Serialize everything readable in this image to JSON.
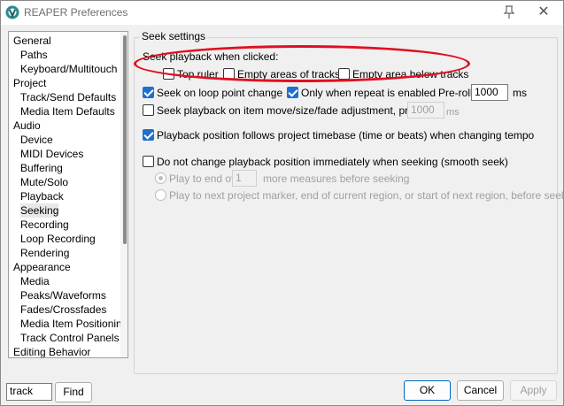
{
  "window": {
    "title": "REAPER Preferences"
  },
  "nav": {
    "items": [
      {
        "label": "General",
        "level": "cat"
      },
      {
        "label": "Paths",
        "level": "sub"
      },
      {
        "label": "Keyboard/Multitouch",
        "level": "sub"
      },
      {
        "label": "Project",
        "level": "cat"
      },
      {
        "label": "Track/Send Defaults",
        "level": "sub"
      },
      {
        "label": "Media Item Defaults",
        "level": "sub"
      },
      {
        "label": "Audio",
        "level": "cat"
      },
      {
        "label": "Device",
        "level": "sub"
      },
      {
        "label": "MIDI Devices",
        "level": "sub"
      },
      {
        "label": "Buffering",
        "level": "sub"
      },
      {
        "label": "Mute/Solo",
        "level": "sub"
      },
      {
        "label": "Playback",
        "level": "sub"
      },
      {
        "label": "Seeking",
        "level": "sub",
        "selected": true
      },
      {
        "label": "Recording",
        "level": "sub"
      },
      {
        "label": "Loop Recording",
        "level": "sub"
      },
      {
        "label": "Rendering",
        "level": "sub"
      },
      {
        "label": "Appearance",
        "level": "cat"
      },
      {
        "label": "Media",
        "level": "sub"
      },
      {
        "label": "Peaks/Waveforms",
        "level": "sub"
      },
      {
        "label": "Fades/Crossfades",
        "level": "sub"
      },
      {
        "label": "Media Item Positioning",
        "level": "sub"
      },
      {
        "label": "Track Control Panels",
        "level": "sub"
      },
      {
        "label": "Editing Behavior",
        "level": "cat"
      }
    ]
  },
  "settings": {
    "group_title": "Seek settings",
    "seek_click_label": "Seek playback when clicked:",
    "top_ruler": {
      "label": "Top ruler",
      "checked": false
    },
    "empty_tracks": {
      "label": "Empty areas of tracks",
      "checked": false
    },
    "empty_below": {
      "label": "Empty area below tracks",
      "checked": false
    },
    "seek_loop": {
      "label": "Seek on loop point change",
      "checked": true
    },
    "only_repeat": {
      "label": "Only when repeat is enabled",
      "checked": true
    },
    "preroll1": {
      "label": "Pre-roll:",
      "value": "1000",
      "unit": "ms"
    },
    "seek_item": {
      "label": "Seek playback on item move/size/fade adjustment, pre-roll:",
      "checked": false
    },
    "preroll2": {
      "value": "1000",
      "unit": "ms"
    },
    "follow_timebase": {
      "label": "Playback position follows project timebase (time or beats) when changing tempo",
      "checked": true
    },
    "smooth_seek": {
      "label": "Do not change playback position immediately when seeking (smooth seek)",
      "checked": false
    },
    "play_end": {
      "label": "Play to end of",
      "value": "1",
      "suffix": "more measures before seeking",
      "selected": true
    },
    "play_next": {
      "label": "Play to next project marker, end of current region, or start of next region, before seeking",
      "selected": false
    }
  },
  "footer": {
    "search_value": "track",
    "find_label": "Find",
    "ok_label": "OK",
    "cancel_label": "Cancel",
    "apply_label": "Apply"
  },
  "colors": {
    "accent": "#1f6fcf",
    "annotation": "#e01020"
  }
}
